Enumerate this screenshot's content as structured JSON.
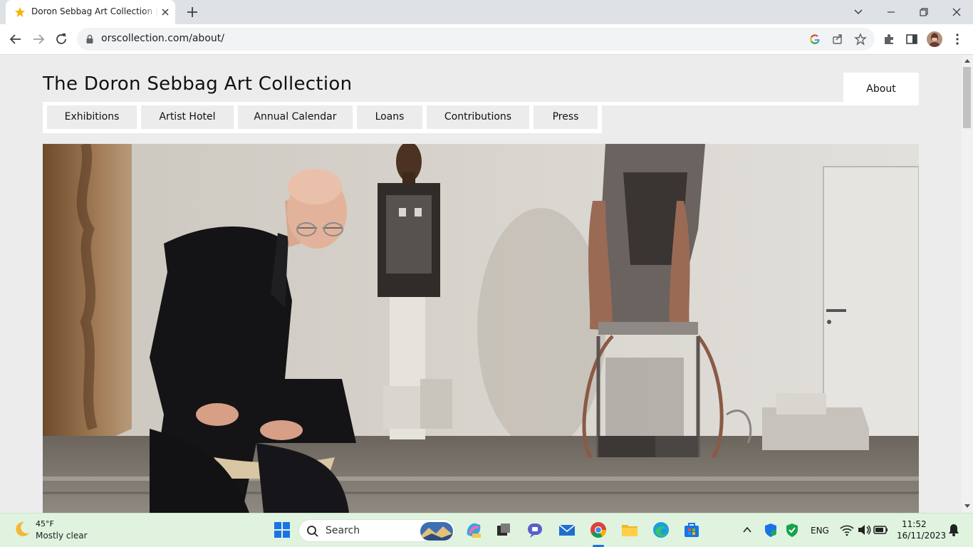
{
  "browser": {
    "tab_title": "Doron Sebbag Art Collection | o",
    "url": "orscollection.com/about/"
  },
  "site": {
    "title": "The Doron Sebbag Art Collection",
    "about": "About",
    "nav": [
      "Exhibitions",
      "Artist Hotel",
      "Annual Calendar",
      "Loans",
      "Contributions",
      "Press"
    ]
  },
  "taskbar": {
    "weather_temp": "45°F",
    "weather_desc": "Mostly clear",
    "search_placeholder": "Search",
    "language": "ENG",
    "time": "11:52",
    "date": "16/11/2023"
  },
  "colors": {
    "page_bg": "#ececec",
    "nav_bg": "#ffffff",
    "taskbar_bg": "#dff3df",
    "accent": "#1a73e8"
  },
  "icons": [
    "star-favicon-icon",
    "close-icon",
    "plus-icon",
    "chevron-down-icon",
    "minimize-icon",
    "restore-icon",
    "back-icon",
    "forward-icon",
    "reload-icon",
    "lock-icon",
    "google-icon",
    "share-icon",
    "bookmark-star-icon",
    "extensions-icon",
    "side-panel-icon",
    "menu-dots-icon",
    "moon-icon",
    "windows-start-icon",
    "search-icon",
    "bell-icon"
  ]
}
